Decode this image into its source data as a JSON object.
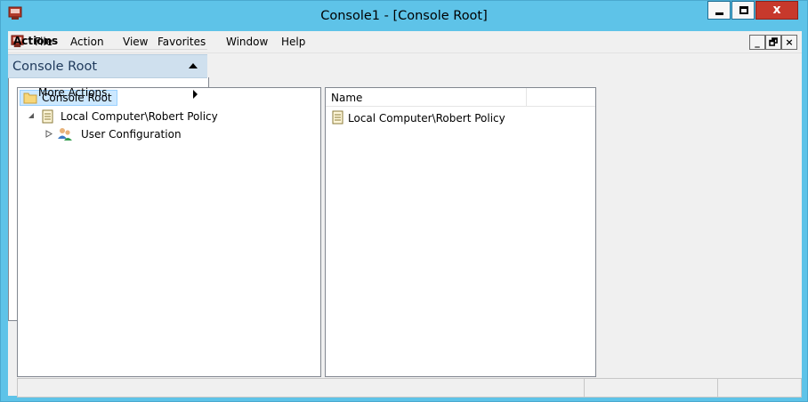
{
  "window": {
    "title": "Console1 - [Console Root]",
    "close_glyph": "x",
    "title_bar_color": "#5ec3e8",
    "close_button_color": "#c7392c"
  },
  "menu": {
    "items": [
      "File",
      "Action",
      "View",
      "Favorites",
      "Window",
      "Help"
    ],
    "mdi_minimize": "_",
    "mdi_restore": "🗗",
    "mdi_close": "×"
  },
  "toolbar": {
    "icons": [
      "back-arrow-icon",
      "forward-arrow-icon",
      "show-hide-console-tree-icon",
      "export-list-icon",
      "help-icon",
      "show-hide-action-pane-icon"
    ]
  },
  "tree": {
    "root_label": "Console Root",
    "policy_label": "Local Computer\\Robert Policy",
    "user_config_label": "User Configuration",
    "selection_color": "#cce8ff"
  },
  "list": {
    "column_name": "Name",
    "rows": [
      "Local Computer\\Robert Policy"
    ]
  },
  "actions": {
    "header": "Actions",
    "group_title": "Console Root",
    "more_actions": "More Actions",
    "group_color": "#cfe0ee"
  },
  "statusbar": {
    "main_text": ""
  }
}
